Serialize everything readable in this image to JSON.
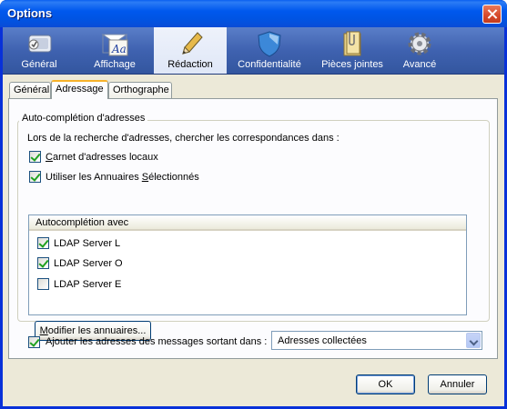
{
  "window": {
    "title": "Options"
  },
  "toolbar": {
    "items": [
      {
        "label": "Général",
        "icon": "general-settings-icon"
      },
      {
        "label": "Affichage",
        "icon": "display-icon"
      },
      {
        "label": "Rédaction",
        "icon": "pencil-icon"
      },
      {
        "label": "Confidentialité",
        "icon": "shield-icon"
      },
      {
        "label": "Pièces jointes",
        "icon": "folder-paperclip-icon"
      },
      {
        "label": "Avancé",
        "icon": "gear-icon"
      }
    ],
    "selected": "Rédaction"
  },
  "tabs": [
    {
      "label": "Général"
    },
    {
      "label": "Adressage"
    },
    {
      "label": "Orthographe"
    }
  ],
  "active_tab": "Adressage",
  "autocomplete": {
    "legend": "Auto-complétion d'adresses",
    "search_label": "Lors de la recherche d'adresses, chercher les correspondances dans :",
    "local_book": {
      "prefix": "",
      "accel": "C",
      "rest": "arnet d'adresses locaux",
      "checked": true
    },
    "directories": {
      "prefix": "Utiliser les Annuaires ",
      "accel": "S",
      "rest": "électionnés",
      "checked": true
    },
    "list_header": "Autocomplétion avec",
    "servers": [
      {
        "label": "LDAP Server L",
        "checked": true
      },
      {
        "label": "LDAP Server O",
        "checked": true
      },
      {
        "label": "LDAP Server E",
        "checked": false
      }
    ],
    "edit_button": {
      "accel": "M",
      "rest": "odifier les annuaires..."
    }
  },
  "outgoing": {
    "label": "Ajouter les adresses des messages sortant dans :",
    "checked": true,
    "selected_book": "Adresses collectées"
  },
  "footer": {
    "ok_label": "OK",
    "cancel_label": "Annuler"
  },
  "colors": {
    "title_bar": "#0054e3",
    "toolbar": "#3f62b0",
    "dialog_bg": "#ece9d8",
    "tab_accent": "#f7b22a"
  }
}
